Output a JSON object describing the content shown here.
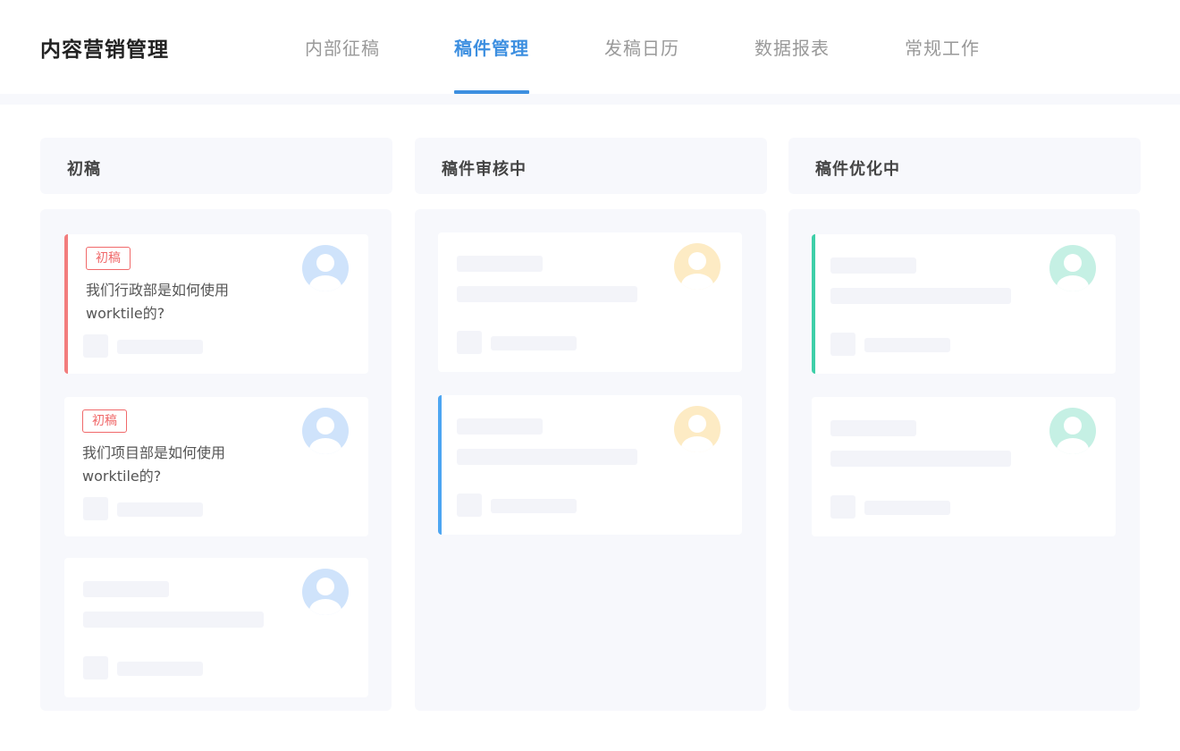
{
  "app": {
    "title": "内容营销管理"
  },
  "tabs": [
    {
      "label": "内部征稿"
    },
    {
      "label": "稿件管理"
    },
    {
      "label": "发稿日历"
    },
    {
      "label": "数据报表"
    },
    {
      "label": "常规工作"
    }
  ],
  "columns": [
    {
      "title": "初稿",
      "cards": [
        {
          "tag": "初稿",
          "title": "我们行政部是如何使用worktile的?"
        },
        {
          "tag": "初稿",
          "title": "我们项目部是如何使用worktile的?"
        },
        {}
      ]
    },
    {
      "title": "稿件审核中",
      "cards": [
        {},
        {}
      ]
    },
    {
      "title": "稿件优化中",
      "cards": [
        {},
        {}
      ]
    }
  ],
  "colors": {
    "accent": "#3d8fe0",
    "red": "#f27d7d",
    "blue": "#4da6f2",
    "green": "#3ecfa8",
    "avatar_blue": "#cfe3fb",
    "avatar_yellow": "#fdebc4",
    "avatar_green": "#c5f0e4"
  },
  "icons": {
    "avatar": "user-avatar-icon"
  }
}
